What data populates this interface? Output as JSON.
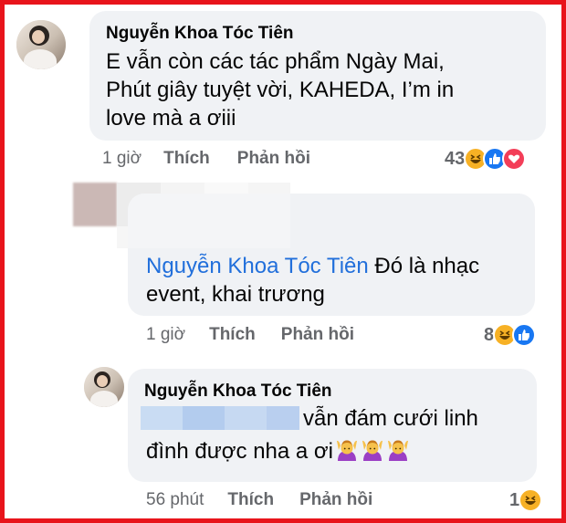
{
  "comments": [
    {
      "author": "Nguyễn Khoa Tóc Tiên",
      "text_lines": [
        "E vẫn còn các tác phẩm Ngày Mai,",
        "Phút giây tuyệt vời, KAHEDA, I’m in",
        "love mà a ơiii"
      ],
      "time": "1 giờ",
      "like_label": "Thích",
      "reply_label": "Phản hồi",
      "reaction_count": "43",
      "reactions": [
        "haha-icon",
        "like-icon",
        "love-icon"
      ]
    },
    {
      "mention": "Nguyễn Khoa Tóc Tiên",
      "text_first": " Đó là nhạc",
      "text_second": "event, khai trương",
      "time": "1 giờ",
      "like_label": "Thích",
      "reply_label": "Phản hồi",
      "reaction_count": "8",
      "reactions": [
        "haha-icon",
        "like-icon"
      ]
    },
    {
      "author": "Nguyễn Khoa Tóc Tiên",
      "text_first": "vẫn đám cưới linh",
      "text_second": "đình được nha a ơi",
      "time": "56 phút",
      "like_label": "Thích",
      "reply_label": "Phản hồi",
      "reaction_count": "1",
      "reactions": [
        "haha-icon"
      ]
    }
  ],
  "colors": {
    "frame_border": "#e8141b",
    "bubble_bg": "#f0f2f5",
    "mention": "#216fdb",
    "meta": "#65676b"
  }
}
